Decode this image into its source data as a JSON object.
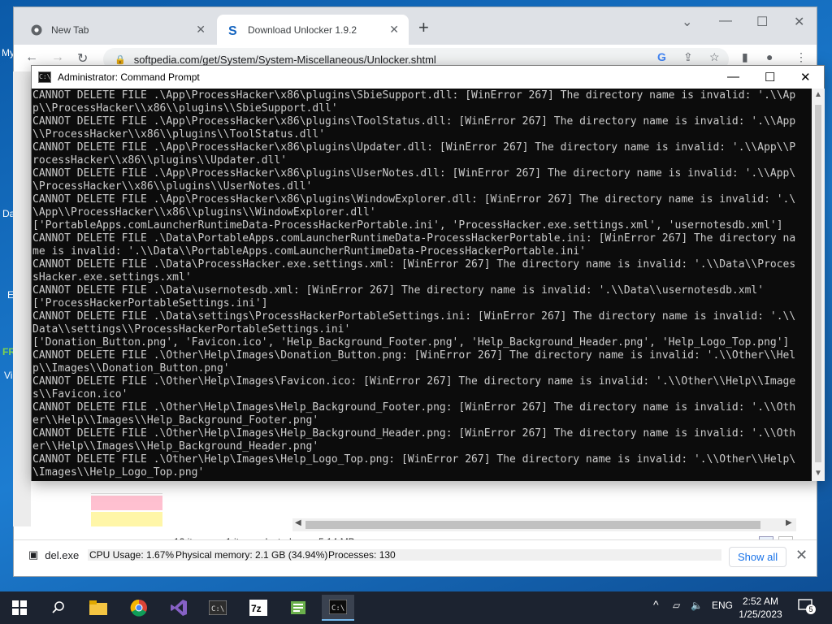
{
  "browser": {
    "tabs": [
      {
        "title": "New Tab",
        "icon": "chrome-icon"
      },
      {
        "title": "Download Unlocker 1.9.2",
        "icon": "softpedia-icon"
      }
    ],
    "url": "softpedia.com/get/System/System-Miscellaneous/Unlocker.shtml",
    "download": {
      "filename": "del.exe",
      "show_all": "Show all"
    }
  },
  "desktop": {
    "labels": [
      "My",
      "Da",
      "E",
      "FR",
      "Vi"
    ]
  },
  "explorer": {
    "items_count": "12 items",
    "selected": "1 item selected",
    "size": "5.14 MB"
  },
  "taskmanager": {
    "cpu": "CPU Usage: 1.67%",
    "memory": "Physical memory: 2.1 GB (34.94%)",
    "processes": "Processes: 130"
  },
  "cmd": {
    "title": "Administrator: Command Prompt",
    "lines": [
      "CANNOT DELETE FILE .\\App\\ProcessHacker\\x86\\plugins\\SbieSupport.dll: [WinError 267] The directory name is invalid: '.\\\\Ap",
      "p\\\\ProcessHacker\\\\x86\\\\plugins\\\\SbieSupport.dll'",
      "CANNOT DELETE FILE .\\App\\ProcessHacker\\x86\\plugins\\ToolStatus.dll: [WinError 267] The directory name is invalid: '.\\\\App",
      "\\\\ProcessHacker\\\\x86\\\\plugins\\\\ToolStatus.dll'",
      "CANNOT DELETE FILE .\\App\\ProcessHacker\\x86\\plugins\\Updater.dll: [WinError 267] The directory name is invalid: '.\\\\App\\\\P",
      "rocessHacker\\\\x86\\\\plugins\\\\Updater.dll'",
      "CANNOT DELETE FILE .\\App\\ProcessHacker\\x86\\plugins\\UserNotes.dll: [WinError 267] The directory name is invalid: '.\\\\App\\",
      "\\ProcessHacker\\\\x86\\\\plugins\\\\UserNotes.dll'",
      "CANNOT DELETE FILE .\\App\\ProcessHacker\\x86\\plugins\\WindowExplorer.dll: [WinError 267] The directory name is invalid: '.\\",
      "\\App\\\\ProcessHacker\\\\x86\\\\plugins\\\\WindowExplorer.dll'",
      "['PortableApps.comLauncherRuntimeData-ProcessHackerPortable.ini', 'ProcessHacker.exe.settings.xml', 'usernotesdb.xml']",
      "CANNOT DELETE FILE .\\Data\\PortableApps.comLauncherRuntimeData-ProcessHackerPortable.ini: [WinError 267] The directory na",
      "me is invalid: '.\\\\Data\\\\PortableApps.comLauncherRuntimeData-ProcessHackerPortable.ini'",
      "CANNOT DELETE FILE .\\Data\\ProcessHacker.exe.settings.xml: [WinError 267] The directory name is invalid: '.\\\\Data\\\\Proces",
      "sHacker.exe.settings.xml'",
      "CANNOT DELETE FILE .\\Data\\usernotesdb.xml: [WinError 267] The directory name is invalid: '.\\\\Data\\\\usernotesdb.xml'",
      "['ProcessHackerPortableSettings.ini']",
      "CANNOT DELETE FILE .\\Data\\settings\\ProcessHackerPortableSettings.ini: [WinError 267] The directory name is invalid: '.\\\\",
      "Data\\\\settings\\\\ProcessHackerPortableSettings.ini'",
      "['Donation_Button.png', 'Favicon.ico', 'Help_Background_Footer.png', 'Help_Background_Header.png', 'Help_Logo_Top.png']",
      "CANNOT DELETE FILE .\\Other\\Help\\Images\\Donation_Button.png: [WinError 267] The directory name is invalid: '.\\\\Other\\\\Hel",
      "p\\\\Images\\\\Donation_Button.png'",
      "CANNOT DELETE FILE .\\Other\\Help\\Images\\Favicon.ico: [WinError 267] The directory name is invalid: '.\\\\Other\\\\Help\\\\Image",
      "s\\\\Favicon.ico'",
      "CANNOT DELETE FILE .\\Other\\Help\\Images\\Help_Background_Footer.png: [WinError 267] The directory name is invalid: '.\\\\Oth",
      "er\\\\Help\\\\Images\\\\Help_Background_Footer.png'",
      "CANNOT DELETE FILE .\\Other\\Help\\Images\\Help_Background_Header.png: [WinError 267] The directory name is invalid: '.\\\\Oth",
      "er\\\\Help\\\\Images\\\\Help_Background_Header.png'",
      "CANNOT DELETE FILE .\\Other\\Help\\Images\\Help_Logo_Top.png: [WinError 267] The directory name is invalid: '.\\\\Other\\\\Help\\",
      "\\Images\\\\Help_Logo_Top.png'"
    ]
  },
  "taskbar": {
    "apps": [
      "file-explorer-icon",
      "chrome-icon",
      "visual-studio-icon",
      "terminal-icon",
      "7zip-icon",
      "notepad-icon",
      "cmd-icon"
    ],
    "language": "ENG",
    "time": "2:52 AM",
    "date": "1/25/2023",
    "notification_count": "5"
  },
  "colors": {
    "console_bg": "#0c0c0c",
    "console_fg": "#cccccc",
    "taskbar_bg": "#1c2330",
    "desktop_bg": "#1d7dd1"
  }
}
